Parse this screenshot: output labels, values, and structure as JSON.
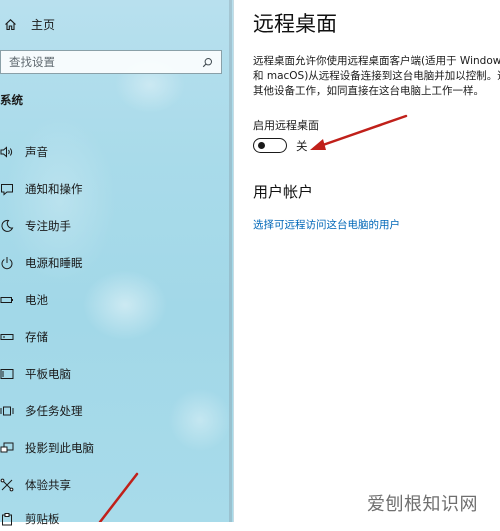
{
  "sidebar": {
    "home_label": "主页",
    "search_placeholder": "查找设置",
    "section_title": "系统",
    "items": [
      {
        "label": "声音",
        "icon": "speaker-icon"
      },
      {
        "label": "通知和操作",
        "icon": "notification-icon"
      },
      {
        "label": "专注助手",
        "icon": "moon-icon"
      },
      {
        "label": "电源和睡眠",
        "icon": "power-icon"
      },
      {
        "label": "电池",
        "icon": "battery-icon"
      },
      {
        "label": "存储",
        "icon": "storage-icon"
      },
      {
        "label": "平板电脑",
        "icon": "tablet-icon"
      },
      {
        "label": "多任务处理",
        "icon": "multitask-icon"
      },
      {
        "label": "投影到此电脑",
        "icon": "project-icon"
      },
      {
        "label": "体验共享",
        "icon": "share-icon"
      },
      {
        "label": "剪贴板",
        "icon": "clipboard-icon"
      }
    ]
  },
  "main": {
    "title": "远程桌面",
    "description_lines": [
      "远程桌面允许你使用远程桌面客户端(适用于 Windows",
      "和 macOS)从远程设备连接到这台电脑并加以控制。通",
      "其他设备工作，如同直接在这台电脑上工作一样。"
    ],
    "toggle_label": "启用远程桌面",
    "toggle_state": "关",
    "toggle_on": false,
    "user_heading": "用户帐户",
    "user_link": "选择可远程访问这台电脑的用户"
  },
  "watermark": "爱刨根知识网",
  "colors": {
    "accent": "#0067b8",
    "annotation_arrow": "#c0201a",
    "sidebar_bg": "#a9dbea"
  }
}
